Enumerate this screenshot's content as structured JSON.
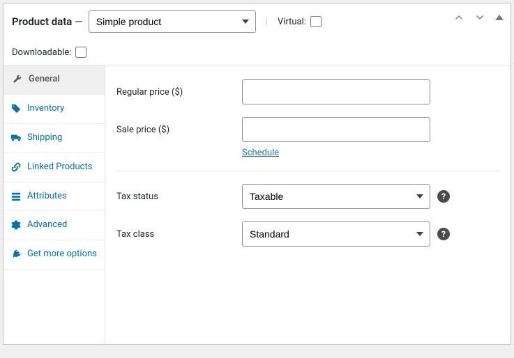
{
  "header": {
    "title": "Product data",
    "dash": "—",
    "product_type": "Simple product",
    "virtual_label": "Virtual:",
    "downloadable_label": "Downloadable:"
  },
  "tabs": [
    {
      "label": "General"
    },
    {
      "label": "Inventory"
    },
    {
      "label": "Shipping"
    },
    {
      "label": "Linked Products"
    },
    {
      "label": "Attributes"
    },
    {
      "label": "Advanced"
    },
    {
      "label": "Get more options"
    }
  ],
  "fields": {
    "regular_price_label": "Regular price ($)",
    "regular_price_value": "",
    "sale_price_label": "Sale price ($)",
    "sale_price_value": "",
    "schedule_link": "Schedule",
    "tax_status_label": "Tax status",
    "tax_status_value": "Taxable",
    "tax_class_label": "Tax class",
    "tax_class_value": "Standard"
  }
}
